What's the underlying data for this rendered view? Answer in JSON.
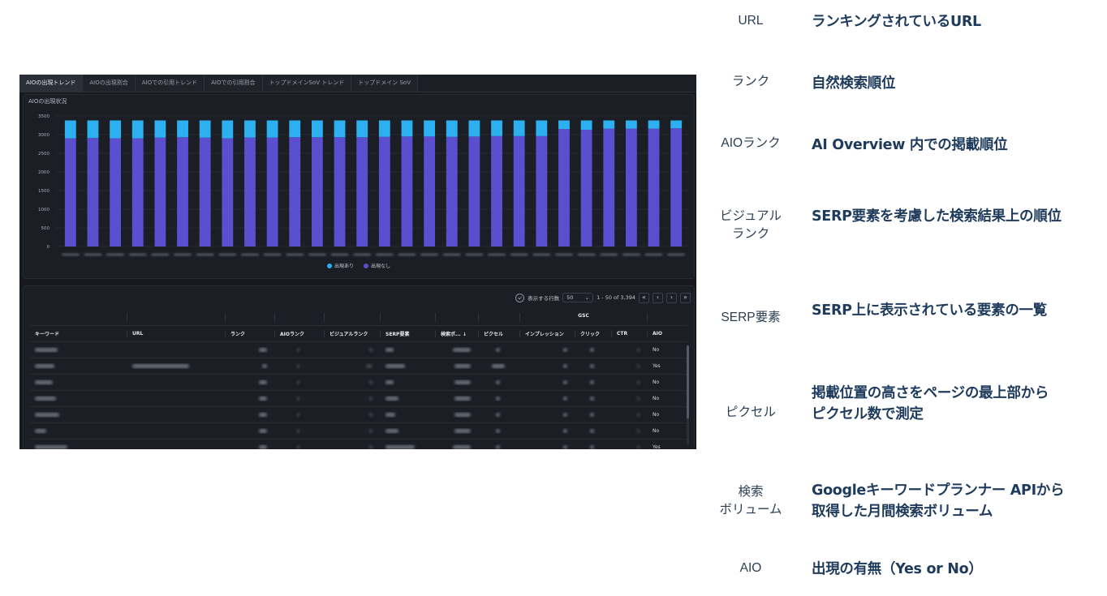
{
  "dashboard": {
    "tabs": [
      "AIOの出現トレンド",
      "AIOの出現割合",
      "AIOでの引用トレンド",
      "AIOでの引用割合",
      "トップドメインSoV トレンド",
      "トップドメイン SoV"
    ],
    "active_tab": 0,
    "chart_title": "AIOの出現状況",
    "pager": {
      "rows_label": "表示する行数",
      "rows_value": "50",
      "range": "1 - 50 of 3,394",
      "first": "«",
      "prev": "‹",
      "next": "›",
      "last": "»"
    },
    "table": {
      "group_header": "GSC",
      "columns": [
        "キーワード",
        "URL",
        "ランク",
        "AIOランク",
        "ビジュアルランク",
        "SERP要素",
        "検索ボ...",
        "ピクセル",
        "インプレッション",
        "クリック",
        "CTR",
        "AIO"
      ],
      "aio_values": [
        "No",
        "Yes",
        "No",
        "No",
        "No",
        "No",
        "Yes"
      ]
    }
  },
  "chart_data": {
    "type": "bar",
    "stacked": true,
    "categories": [],
    "series": [
      {
        "name": "出現なし",
        "color": "#5a4fcf",
        "values": [
          2900,
          2910,
          2900,
          2900,
          2920,
          2930,
          2920,
          2900,
          2920,
          2920,
          2930,
          2930,
          2930,
          2930,
          2940,
          2950,
          2950,
          2940,
          2950,
          2960,
          2960,
          2960,
          3150,
          3130,
          3160,
          3160,
          3160,
          3170
        ]
      },
      {
        "name": "出現あり",
        "color": "#2db0f0",
        "values": [
          480,
          470,
          480,
          480,
          460,
          450,
          460,
          480,
          460,
          460,
          450,
          450,
          450,
          450,
          440,
          430,
          430,
          440,
          430,
          420,
          420,
          420,
          230,
          250,
          220,
          220,
          220,
          210
        ]
      }
    ],
    "yticks": [
      0,
      500,
      1000,
      1500,
      2000,
      2500,
      3000,
      3500
    ],
    "ylim": [
      0,
      3500
    ],
    "grid": true,
    "legend_position": "bottom-center"
  },
  "descriptions": [
    {
      "term": "URL",
      "definition": "ランキングされているURL"
    },
    {
      "term": "ランク",
      "definition": "自然検索順位"
    },
    {
      "term": "AIOランク",
      "definition": "AI Overview 内での掲載順位"
    },
    {
      "term": "ビジュアル\nランク",
      "definition": "SERP要素を考慮した検索結果上の順位"
    },
    {
      "term": "SERP要素",
      "definition": "SERP上に表示されている要素の一覧"
    },
    {
      "term": "ピクセル",
      "definition": "掲載位置の高さをページの最上部から\nピクセル数で測定"
    },
    {
      "term": "検索\nボリューム",
      "definition": "Googleキーワードプランナー APIから\n取得した月間検索ボリューム"
    },
    {
      "term": "AIO",
      "definition": "出現の有無（Yes or No）"
    }
  ]
}
